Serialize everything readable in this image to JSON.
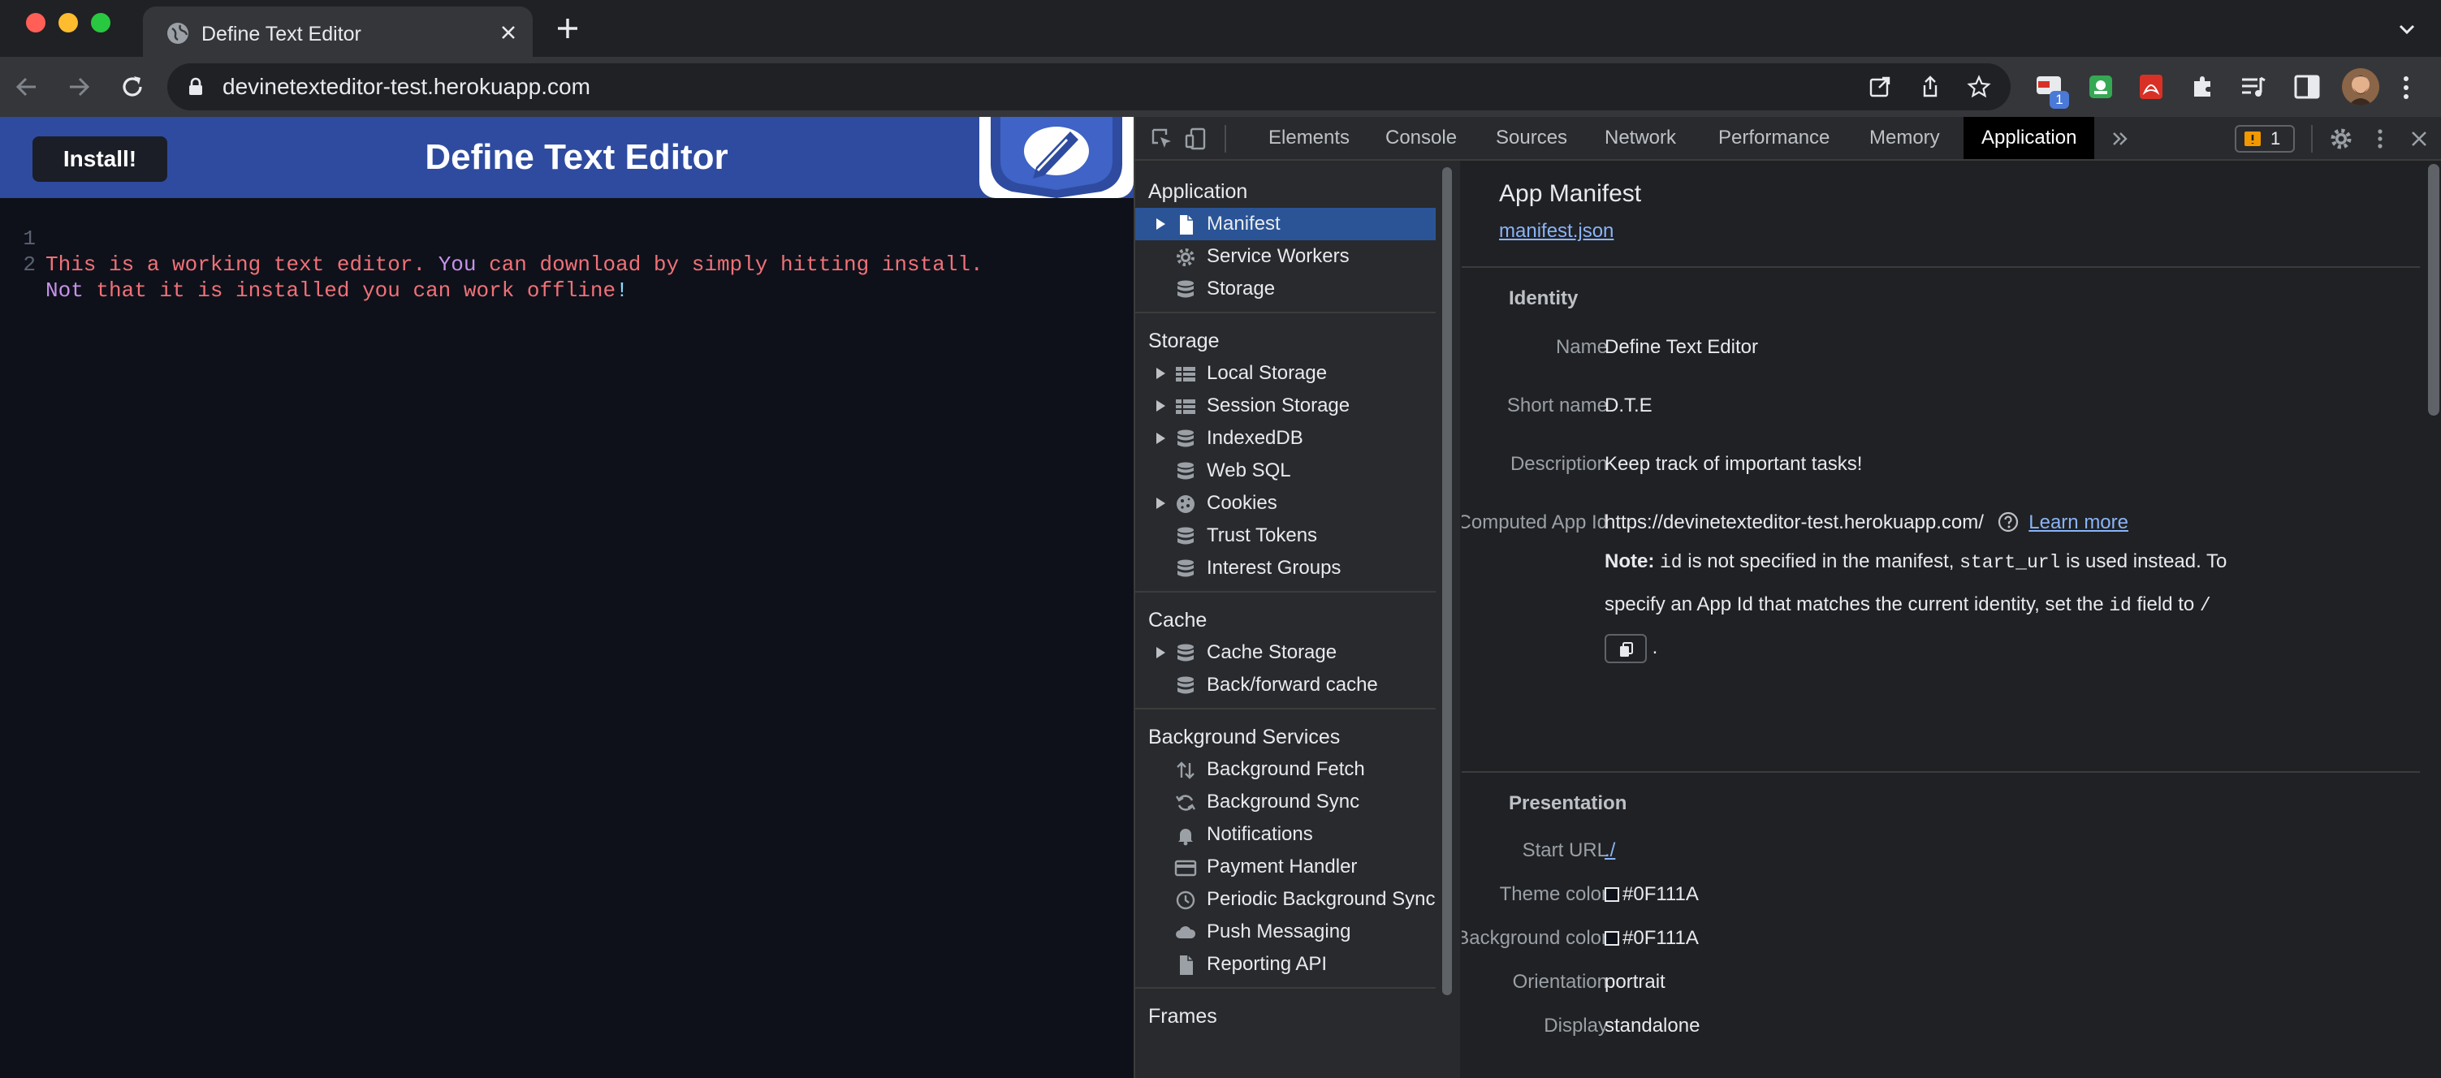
{
  "browser": {
    "tab_title": "Define Text Editor",
    "url": "devinetexteditor-test.herokuapp.com",
    "extension_badge": "1"
  },
  "app": {
    "install_label": "Install!",
    "title": "Define Text Editor",
    "editor_lines": [
      {
        "number": "1",
        "segments": [
          {
            "text": "This is a working text editor. ",
            "color": "#f07178"
          },
          {
            "text": "You",
            "color": "#c792ea"
          },
          {
            "text": " can download by simply hitting install.",
            "color": "#f07178"
          }
        ]
      },
      {
        "number": "2",
        "segments": [
          {
            "text": "Not",
            "color": "#c792ea"
          },
          {
            "text": " that it is installed you can work offline",
            "color": "#f07178"
          },
          {
            "text": "!",
            "color": "#89ddff"
          }
        ]
      }
    ]
  },
  "devtools": {
    "tabs": [
      "Elements",
      "Console",
      "Sources",
      "Network",
      "Performance",
      "Memory",
      "Application"
    ],
    "active_tab": "Application",
    "issues_count": "1",
    "sidebar": {
      "application_header": "Application",
      "application_items": [
        {
          "label": "Manifest",
          "icon": "file-icon",
          "expandable": true,
          "selected": true
        },
        {
          "label": "Service Workers",
          "icon": "gear-icon",
          "expandable": false
        },
        {
          "label": "Storage",
          "icon": "database-icon",
          "expandable": false
        }
      ],
      "storage_header": "Storage",
      "storage_items": [
        {
          "label": "Local Storage",
          "icon": "grid-icon",
          "expandable": true
        },
        {
          "label": "Session Storage",
          "icon": "grid-icon",
          "expandable": true
        },
        {
          "label": "IndexedDB",
          "icon": "database-icon",
          "expandable": true
        },
        {
          "label": "Web SQL",
          "icon": "database-icon",
          "expandable": false
        },
        {
          "label": "Cookies",
          "icon": "cookie-icon",
          "expandable": true
        },
        {
          "label": "Trust Tokens",
          "icon": "database-icon",
          "expandable": false
        },
        {
          "label": "Interest Groups",
          "icon": "database-icon",
          "expandable": false
        }
      ],
      "cache_header": "Cache",
      "cache_items": [
        {
          "label": "Cache Storage",
          "icon": "database-icon",
          "expandable": true
        },
        {
          "label": "Back/forward cache",
          "icon": "database-icon",
          "expandable": false
        }
      ],
      "background_header": "Background Services",
      "background_items": [
        {
          "label": "Background Fetch",
          "icon": "arrows-updown-icon"
        },
        {
          "label": "Background Sync",
          "icon": "sync-icon"
        },
        {
          "label": "Notifications",
          "icon": "bell-icon"
        },
        {
          "label": "Payment Handler",
          "icon": "credit-card-icon"
        },
        {
          "label": "Periodic Background Sync",
          "icon": "clock-icon"
        },
        {
          "label": "Push Messaging",
          "icon": "cloud-icon"
        },
        {
          "label": "Reporting API",
          "icon": "file-icon"
        }
      ],
      "frames_header": "Frames"
    },
    "manifest": {
      "title": "App Manifest",
      "link": "manifest.json",
      "identity_header": "Identity",
      "name_key": "Name",
      "name": "Define Text Editor",
      "short_name_key": "Short name",
      "short_name": "D.T.E",
      "description_key": "Description",
      "description": "Keep track of important tasks!",
      "app_id_key": "Computed App Id",
      "app_id": "https://devinetexteditor-test.herokuapp.com/",
      "learn_more": "Learn more",
      "note_label": "Note:",
      "note_id": "id",
      "note_part1": " is not specified in the manifest, ",
      "note_start_url": "start_url",
      "note_part2": " is used instead. To specify an App Id that matches the current identity, set the ",
      "note_id2": "id",
      "note_part3": " field to ",
      "note_slash": "/",
      "note_end": ".",
      "presentation_header": "Presentation",
      "start_url_key": "Start URL",
      "start_url": "./",
      "theme_color_key": "Theme color",
      "theme_color": "#0F111A",
      "background_color_key": "Background color",
      "background_color": "#0F111A",
      "orientation_key": "Orientation",
      "orientation": "portrait",
      "display_key": "Display",
      "display": "standalone"
    }
  }
}
